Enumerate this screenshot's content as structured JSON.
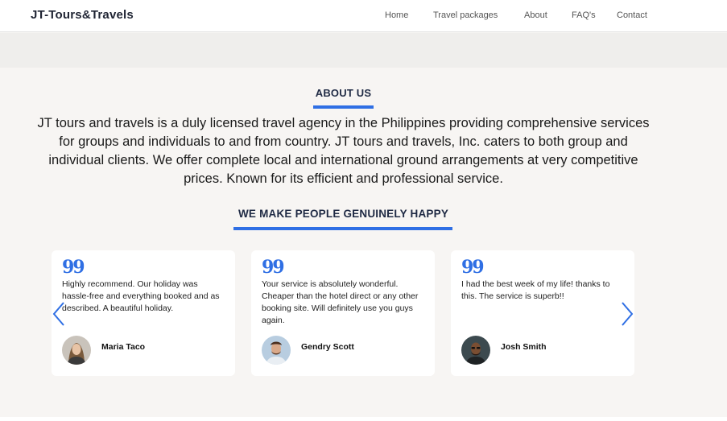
{
  "header": {
    "brand": "JT-Tours&Travels",
    "nav": [
      {
        "label": "Home"
      },
      {
        "label": "Travel packages"
      },
      {
        "label": "About"
      },
      {
        "label": "FAQ's"
      },
      {
        "label": "Contact"
      }
    ]
  },
  "about": {
    "title": "ABOUT US",
    "text": "JT tours and travels is a duly licensed travel agency in the Philippines providing comprehensive services for groups and individuals to and from country. JT tours and travels, Inc. caters to both group and individual clients. We offer complete local and international ground arrangements at very competitive prices. Known for its efficient and professional service."
  },
  "testimonials": {
    "title": "WE MAKE PEOPLE GENUINELY HAPPY",
    "quote_mark": "99",
    "items": [
      {
        "text": "Highly recommend. Our holiday was hassle-free and everything booked and as described. A beautiful holiday.",
        "name": "Maria Taco"
      },
      {
        "text": "Your service is absolutely wonderful. Cheaper than the hotel direct or any other booking site. Will definitely use you guys again.",
        "name": "Gendry Scott"
      },
      {
        "text": "I had the best week of my life! thanks to this. The service is superb!!",
        "name": "Josh Smith"
      }
    ],
    "prev_icon": "chevron-left-icon",
    "next_icon": "chevron-right-icon"
  },
  "colors": {
    "accent": "#2f6fe4",
    "heading": "#1f2a44",
    "background": "#f7f5f3"
  }
}
